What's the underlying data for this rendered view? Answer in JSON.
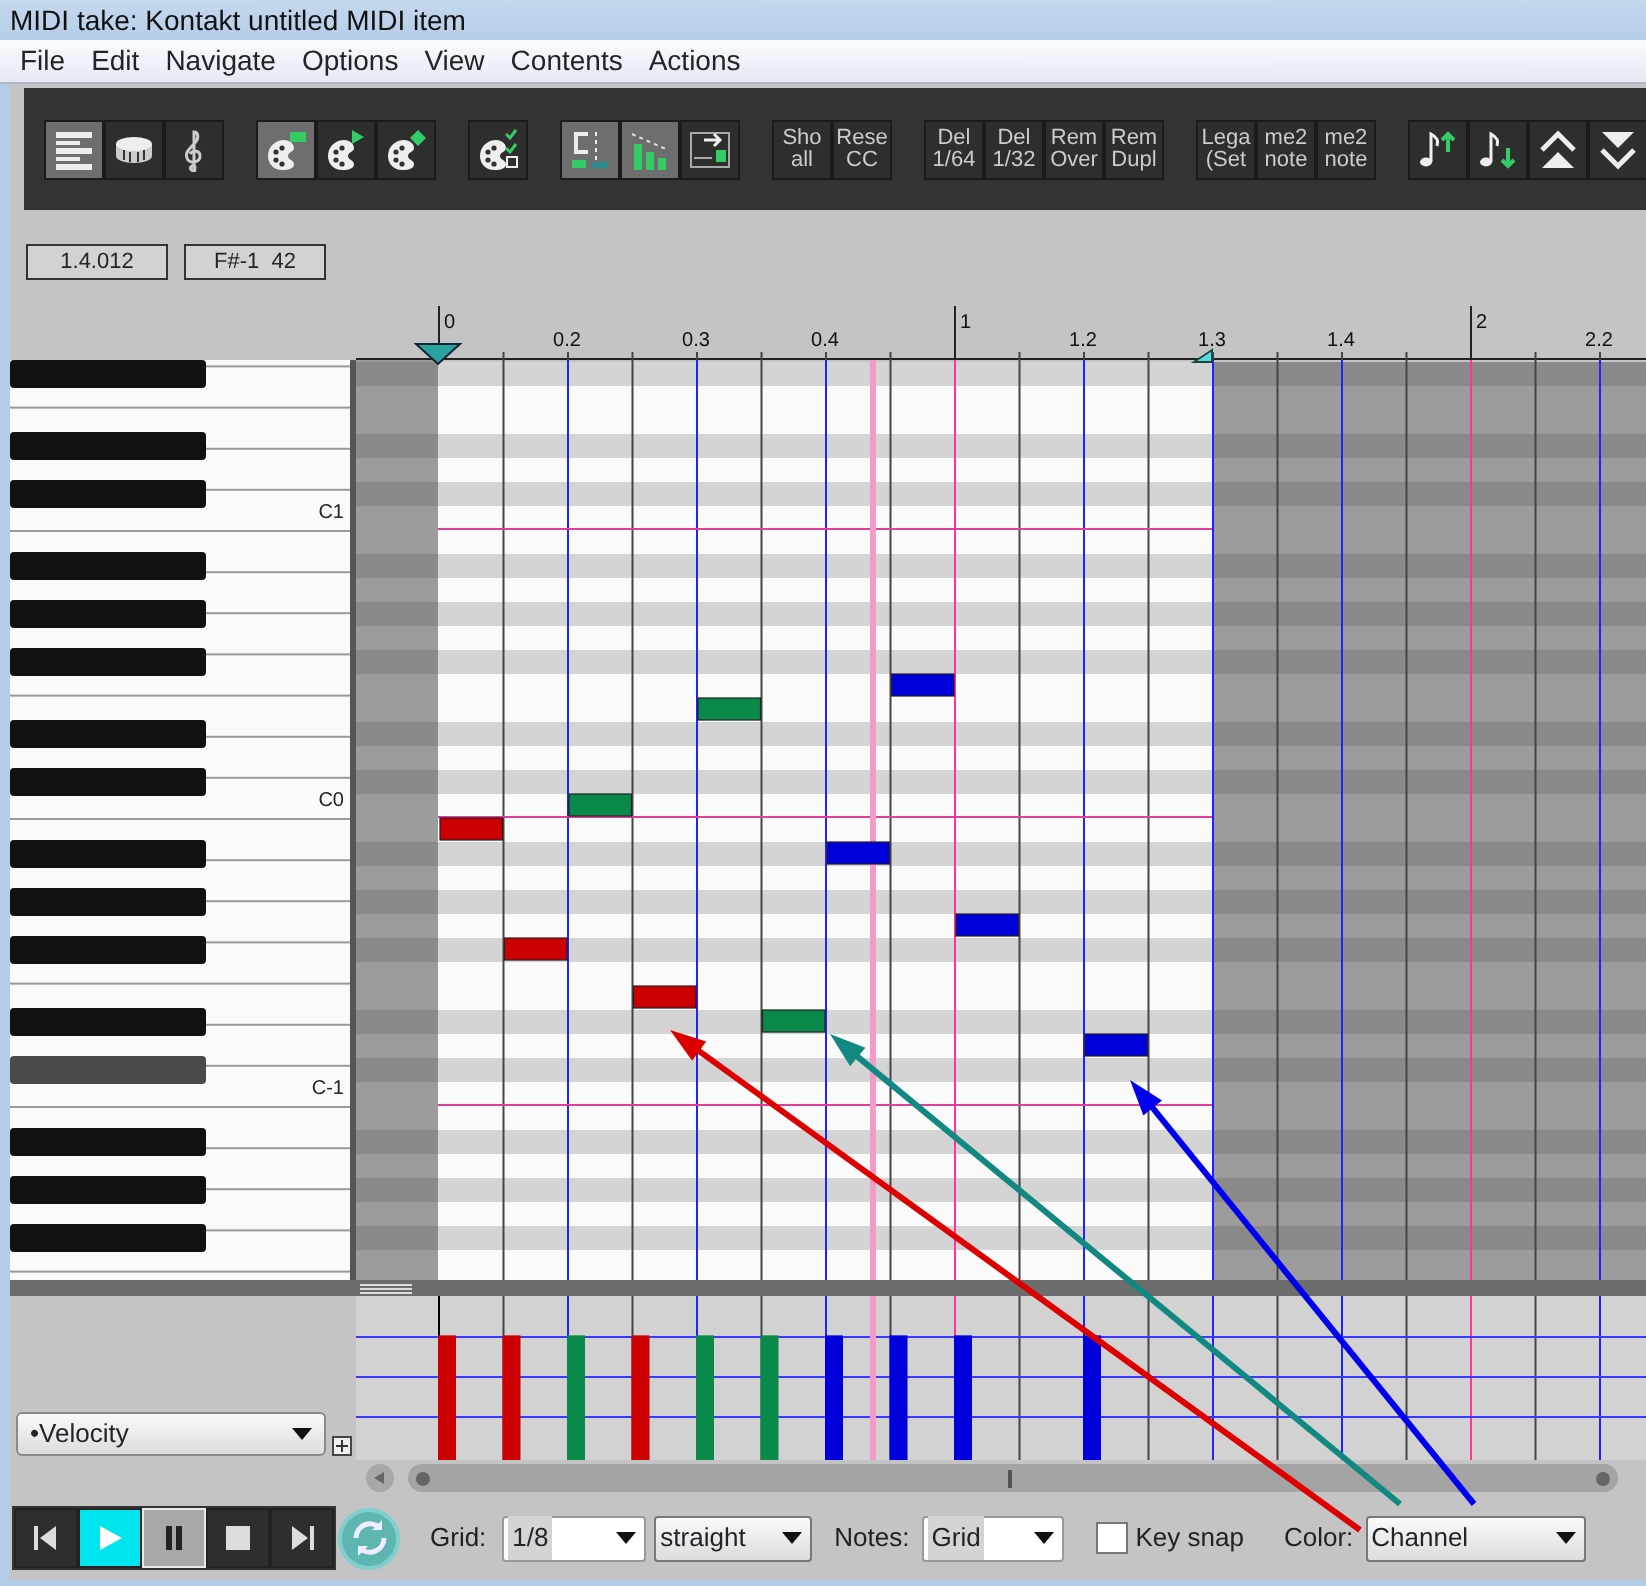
{
  "window": {
    "title": "MIDI take: Kontakt untitled MIDI item"
  },
  "menu": [
    "File",
    "Edit",
    "Navigate",
    "Options",
    "View",
    "Contents",
    "Actions"
  ],
  "toolbar": {
    "groups": [
      {
        "buttons": [
          {
            "kind": "icon",
            "selected": true
          },
          {
            "kind": "icon",
            "selected": false
          },
          {
            "kind": "icon",
            "selected": false
          }
        ]
      },
      {
        "buttons": [
          {
            "kind": "icon",
            "selected": true
          },
          {
            "kind": "icon",
            "selected": false
          },
          {
            "kind": "icon",
            "selected": false
          }
        ]
      },
      {
        "buttons": [
          {
            "kind": "icon",
            "selected": false
          }
        ]
      },
      {
        "buttons": [
          {
            "kind": "icon",
            "selected": true
          },
          {
            "kind": "icon",
            "selected": true
          },
          {
            "kind": "icon",
            "selected": false
          }
        ]
      },
      {
        "buttons": [
          {
            "kind": "text",
            "lines": [
              "Sho",
              "all"
            ],
            "selected": false
          },
          {
            "kind": "text",
            "lines": [
              "Rese",
              "CC"
            ],
            "selected": false
          }
        ]
      },
      {
        "buttons": [
          {
            "kind": "text",
            "lines": [
              "Del",
              "1/64"
            ],
            "selected": false
          },
          {
            "kind": "text",
            "lines": [
              "Del",
              "1/32"
            ],
            "selected": false
          },
          {
            "kind": "text",
            "lines": [
              "Rem",
              "Over"
            ],
            "selected": false
          },
          {
            "kind": "text",
            "lines": [
              "Rem",
              "Dupl"
            ],
            "selected": false
          }
        ]
      },
      {
        "buttons": [
          {
            "kind": "text",
            "lines": [
              "Lega",
              "(Set"
            ],
            "selected": false
          },
          {
            "kind": "text",
            "lines": [
              "me2",
              "note"
            ],
            "selected": false
          },
          {
            "kind": "text",
            "lines": [
              "me2",
              "note"
            ],
            "selected": false
          }
        ]
      },
      {
        "buttons": [
          {
            "kind": "icon",
            "selected": false
          },
          {
            "kind": "icon",
            "selected": false
          },
          {
            "kind": "icon",
            "selected": false
          },
          {
            "kind": "icon",
            "selected": false
          }
        ]
      }
    ]
  },
  "position_fields": [
    "1.4.012",
    "F#-1  42"
  ],
  "ruler": {
    "labels": [
      "0",
      "0.2",
      "0.3",
      "0.4",
      "1",
      "1.2",
      "1.3",
      "1.4",
      "2",
      "2.2"
    ]
  },
  "keyboard": {
    "octave_labels": [
      "C1",
      "C0",
      "C-1"
    ],
    "black_keys": [
      {
        "selected": false
      },
      {
        "selected": false
      },
      {
        "selected": false
      },
      {
        "selected": false
      },
      {
        "selected": false
      },
      {
        "selected": false
      },
      {
        "selected": false
      },
      {
        "selected": false
      },
      {
        "selected": false
      },
      {
        "selected": false
      },
      {
        "selected": false
      },
      {
        "selected": false
      },
      {
        "selected": true
      },
      {
        "selected": false
      },
      {
        "selected": false
      },
      {
        "selected": false
      }
    ]
  },
  "notes": [
    {
      "color": "#cc0000",
      "level": 0.76
    },
    {
      "color": "#cc0000",
      "level": 0.76
    },
    {
      "color": "#0a8a4a",
      "level": 0.76
    },
    {
      "color": "#cc0000",
      "level": 0.76
    },
    {
      "color": "#0a8a4a",
      "level": 0.76
    },
    {
      "color": "#0a8a4a",
      "level": 0.76
    },
    {
      "color": "#0000dd",
      "level": 0.76
    },
    {
      "color": "#0000dd",
      "level": 0.76
    },
    {
      "color": "#0000dd",
      "level": 0.76
    },
    {
      "color": "#0000dd",
      "level": 0.76
    }
  ],
  "cc_lane": {
    "lane": "•Velocity"
  },
  "transport": {
    "buttons": [
      {
        "selected": false,
        "pressed": false
      },
      {
        "selected": true,
        "pressed": false
      },
      {
        "selected": false,
        "pressed": true
      },
      {
        "selected": false,
        "pressed": false
      },
      {
        "selected": false,
        "pressed": false
      }
    ],
    "loop": {
      "on": true
    }
  },
  "controls": {
    "grid_label": "Grid:",
    "grid_value": "1/8",
    "swing": "straight",
    "notes_label": "Notes:",
    "notes_value": "Grid",
    "key_snap": {
      "label": "Key snap",
      "checked": false
    },
    "color_label": "Color:",
    "color_value": "Channel"
  },
  "annotations": [
    {
      "color": "#dd0000"
    },
    {
      "color": "#118880"
    },
    {
      "color": "#0000ee"
    }
  ]
}
